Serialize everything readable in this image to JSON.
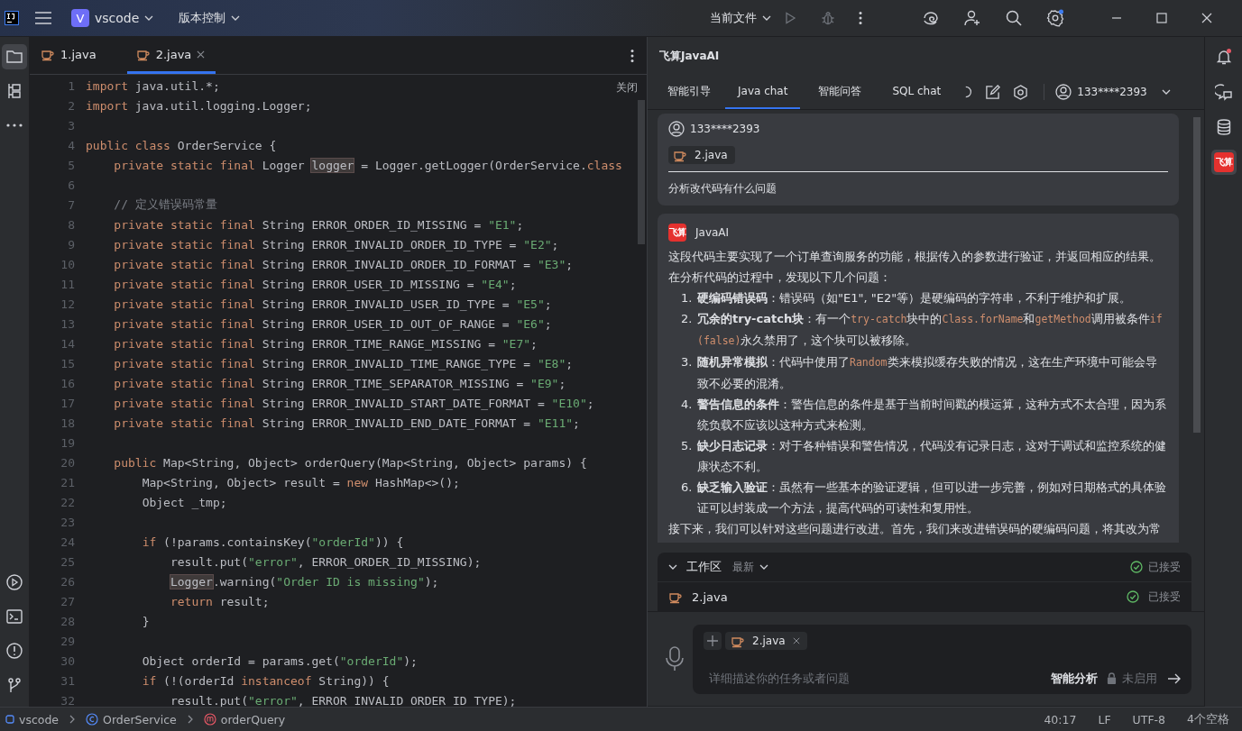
{
  "title_bar": {
    "project_badge": "V",
    "project": "vscode",
    "vcs": "版本控制",
    "run_config": "当前文件"
  },
  "left_toolbar": [
    {
      "kind": "folder",
      "selected": true
    },
    {
      "kind": "structure",
      "selected": false
    },
    {
      "kind": "more",
      "selected": false
    }
  ],
  "left_toolbar_bottom": [
    {
      "kind": "services"
    },
    {
      "kind": "terminal"
    },
    {
      "kind": "problems"
    },
    {
      "kind": "git"
    }
  ],
  "editor": {
    "tabs": [
      {
        "label": "1.java",
        "selected": false
      },
      {
        "label": "2.java",
        "selected": true
      }
    ],
    "close_hint": "关闭",
    "lines": [
      {
        "number": "1",
        "segments": [
          {
            "kind": "kw",
            "text": "import"
          },
          {
            "kind": "pl",
            "text": " java.util.*;"
          }
        ]
      },
      {
        "number": "2",
        "segments": [
          {
            "kind": "kw",
            "text": "import"
          },
          {
            "kind": "pl",
            "text": " java.util.logging.Logger;"
          }
        ]
      },
      {
        "number": "3"
      },
      {
        "number": "4",
        "segments": [
          {
            "kind": "kw",
            "text": "public class"
          },
          {
            "kind": "pl",
            "text": " OrderService {"
          }
        ]
      },
      {
        "number": "5",
        "segments": [
          {
            "kind": "kw",
            "text": "    private static final"
          },
          {
            "kind": "pl",
            "text": " Logger "
          },
          {
            "kind": "hl",
            "text": "logger"
          },
          {
            "kind": "pl",
            "text": " = Logger.getLogger(OrderService."
          },
          {
            "kind": "kw",
            "text": "class"
          }
        ]
      },
      {
        "number": "6"
      },
      {
        "number": "7",
        "segments": [
          {
            "kind": "cmt",
            "text": "    // 定义错误码常量"
          }
        ]
      },
      {
        "number": "8",
        "segments": [
          {
            "kind": "kw",
            "text": "    private static final"
          },
          {
            "kind": "pl",
            "text": " String ERROR_ORDER_ID_MISSING = "
          },
          {
            "kind": "str",
            "text": "\"E1\""
          },
          {
            "kind": "pl",
            "text": ";"
          }
        ]
      },
      {
        "number": "9",
        "segments": [
          {
            "kind": "kw",
            "text": "    private static final"
          },
          {
            "kind": "pl",
            "text": " String ERROR_INVALID_ORDER_ID_TYPE = "
          },
          {
            "kind": "str",
            "text": "\"E2\""
          },
          {
            "kind": "pl",
            "text": ";"
          }
        ]
      },
      {
        "number": "10",
        "segments": [
          {
            "kind": "kw",
            "text": "    private static final"
          },
          {
            "kind": "pl",
            "text": " String ERROR_INVALID_ORDER_ID_FORMAT = "
          },
          {
            "kind": "str",
            "text": "\"E3\""
          },
          {
            "kind": "pl",
            "text": ";"
          }
        ]
      },
      {
        "number": "11",
        "segments": [
          {
            "kind": "kw",
            "text": "    private static final"
          },
          {
            "kind": "pl",
            "text": " String ERROR_USER_ID_MISSING = "
          },
          {
            "kind": "str",
            "text": "\"E4\""
          },
          {
            "kind": "pl",
            "text": ";"
          }
        ]
      },
      {
        "number": "12",
        "segments": [
          {
            "kind": "kw",
            "text": "    private static final"
          },
          {
            "kind": "pl",
            "text": " String ERROR_INVALID_USER_ID_TYPE = "
          },
          {
            "kind": "str",
            "text": "\"E5\""
          },
          {
            "kind": "pl",
            "text": ";"
          }
        ]
      },
      {
        "number": "13",
        "segments": [
          {
            "kind": "kw",
            "text": "    private static final"
          },
          {
            "kind": "pl",
            "text": " String ERROR_USER_ID_OUT_OF_RANGE = "
          },
          {
            "kind": "str",
            "text": "\"E6\""
          },
          {
            "kind": "pl",
            "text": ";"
          }
        ]
      },
      {
        "number": "14",
        "segments": [
          {
            "kind": "kw",
            "text": "    private static final"
          },
          {
            "kind": "pl",
            "text": " String ERROR_TIME_RANGE_MISSING = "
          },
          {
            "kind": "str",
            "text": "\"E7\""
          },
          {
            "kind": "pl",
            "text": ";"
          }
        ]
      },
      {
        "number": "15",
        "segments": [
          {
            "kind": "kw",
            "text": "    private static final"
          },
          {
            "kind": "pl",
            "text": " String ERROR_INVALID_TIME_RANGE_TYPE = "
          },
          {
            "kind": "str",
            "text": "\"E8\""
          },
          {
            "kind": "pl",
            "text": ";"
          }
        ]
      },
      {
        "number": "16",
        "segments": [
          {
            "kind": "kw",
            "text": "    private static final"
          },
          {
            "kind": "pl",
            "text": " String ERROR_TIME_SEPARATOR_MISSING = "
          },
          {
            "kind": "str",
            "text": "\"E9\""
          },
          {
            "kind": "pl",
            "text": ";"
          }
        ]
      },
      {
        "number": "17",
        "segments": [
          {
            "kind": "kw",
            "text": "    private static final"
          },
          {
            "kind": "pl",
            "text": " String ERROR_INVALID_START_DATE_FORMAT = "
          },
          {
            "kind": "str",
            "text": "\"E10\""
          },
          {
            "kind": "pl",
            "text": ";"
          }
        ]
      },
      {
        "number": "18",
        "segments": [
          {
            "kind": "kw",
            "text": "    private static final"
          },
          {
            "kind": "pl",
            "text": " String ERROR_INVALID_END_DATE_FORMAT = "
          },
          {
            "kind": "str",
            "text": "\"E11\""
          },
          {
            "kind": "pl",
            "text": ";"
          }
        ]
      },
      {
        "number": "19"
      },
      {
        "number": "20",
        "segments": [
          {
            "kind": "kw",
            "text": "    public"
          },
          {
            "kind": "pl",
            "text": " Map<String, Object> orderQuery(Map<String, Object> params) {"
          }
        ]
      },
      {
        "number": "21",
        "segments": [
          {
            "kind": "pl",
            "text": "        Map<String, Object> result = "
          },
          {
            "kind": "kw",
            "text": "new"
          },
          {
            "kind": "pl",
            "text": " HashMap<>();"
          }
        ]
      },
      {
        "number": "22",
        "segments": [
          {
            "kind": "pl",
            "text": "        Object _tmp;"
          }
        ]
      },
      {
        "number": "23"
      },
      {
        "number": "24",
        "segments": [
          {
            "kind": "kw",
            "text": "        if"
          },
          {
            "kind": "pl",
            "text": " (!params.containsKey("
          },
          {
            "kind": "str",
            "text": "\"orderId\""
          },
          {
            "kind": "pl",
            "text": ")) {"
          }
        ]
      },
      {
        "number": "25",
        "segments": [
          {
            "kind": "pl",
            "text": "            result.put("
          },
          {
            "kind": "str",
            "text": "\"error\""
          },
          {
            "kind": "pl",
            "text": ", ERROR_ORDER_ID_MISSING);"
          }
        ]
      },
      {
        "number": "26",
        "segments": [
          {
            "kind": "hl",
            "text": "            Logger"
          },
          {
            "kind": "pl",
            "text": ".warning("
          },
          {
            "kind": "str",
            "text": "\"Order ID is missing\""
          },
          {
            "kind": "pl",
            "text": ");"
          }
        ]
      },
      {
        "number": "27",
        "segments": [
          {
            "kind": "kw",
            "text": "            return"
          },
          {
            "kind": "pl",
            "text": " result;"
          }
        ]
      },
      {
        "number": "28",
        "segments": [
          {
            "kind": "pl",
            "text": "        }"
          }
        ]
      },
      {
        "number": "29"
      },
      {
        "number": "30",
        "segments": [
          {
            "kind": "pl",
            "text": "        Object orderId = params.get("
          },
          {
            "kind": "str",
            "text": "\"orderId\""
          },
          {
            "kind": "pl",
            "text": ");"
          }
        ]
      },
      {
        "number": "31",
        "segments": [
          {
            "kind": "kw",
            "text": "        if"
          },
          {
            "kind": "pl",
            "text": " (!(orderId "
          },
          {
            "kind": "kw",
            "text": "instanceof"
          },
          {
            "kind": "pl",
            "text": " String)) {"
          }
        ]
      },
      {
        "number": "32",
        "segments": [
          {
            "kind": "pl",
            "text": "            result.put("
          },
          {
            "kind": "str",
            "text": "\"error\""
          },
          {
            "kind": "pl",
            "text": ", ERROR_INVALID_ORDER_ID_TYPE);"
          }
        ]
      }
    ]
  },
  "chat_panel": {
    "title": "飞算JavaAI",
    "tabs": [
      {
        "label": "智能引导",
        "selected": false
      },
      {
        "label": "Java chat",
        "selected": true
      },
      {
        "label": "智能问答",
        "selected": false
      },
      {
        "label": "SQL chat",
        "selected": false
      }
    ],
    "account": "133****2393",
    "messages": [
      {
        "kind": "user",
        "author": "133****2393",
        "file": "2.java",
        "text": "分析改代码有什么问题"
      },
      {
        "kind": "ai",
        "author": "JavaAI",
        "logo_text": "飞算",
        "intro": "这段代码主要实现了一个订单查询服务的功能，根据传入的参数进行验证，并返回相应的结果。在分析代码的过程中，发现以下几个问题：",
        "items": [
          {
            "number": "1.",
            "segments": [
              {
                "kind": "b",
                "text": "硬编码错误码"
              },
              {
                "kind": "t",
                "text": "：错误码（如\"E1\", \"E2\"等）是硬编码的字符串，不利于维护和扩展。"
              }
            ]
          },
          {
            "number": "2.",
            "segments": [
              {
                "kind": "b",
                "text": "冗余的try-catch块"
              },
              {
                "kind": "t",
                "text": "：有一个"
              },
              {
                "kind": "code",
                "text": "try-catch"
              },
              {
                "kind": "t",
                "text": "块中的"
              },
              {
                "kind": "code",
                "text": "Class.forName"
              },
              {
                "kind": "t",
                "text": "和"
              },
              {
                "kind": "code",
                "text": "getMethod"
              },
              {
                "kind": "t",
                "text": "调用被条件"
              },
              {
                "kind": "code",
                "text": "if (false)"
              },
              {
                "kind": "t",
                "text": "永久禁用了，这个块可以被移除。"
              }
            ]
          },
          {
            "number": "3.",
            "segments": [
              {
                "kind": "b",
                "text": "随机异常模拟"
              },
              {
                "kind": "t",
                "text": "：代码中使用了"
              },
              {
                "kind": "code",
                "text": "Random"
              },
              {
                "kind": "t",
                "text": "类来模拟缓存失败的情况，这在生产环境中可能会导致不必要的混淆。"
              }
            ]
          },
          {
            "number": "4.",
            "segments": [
              {
                "kind": "b",
                "text": "警告信息的条件"
              },
              {
                "kind": "t",
                "text": "：警告信息的条件是基于当前时间戳的模运算，这种方式不太合理，因为系统负载不应该以这种方式来检测。"
              }
            ]
          },
          {
            "number": "5.",
            "segments": [
              {
                "kind": "b",
                "text": "缺少日志记录"
              },
              {
                "kind": "t",
                "text": "：对于各种错误和警告情况，代码没有记录日志，这对于调试和监控系统的健康状态不利。"
              }
            ]
          },
          {
            "number": "6.",
            "segments": [
              {
                "kind": "b",
                "text": "缺乏输入验证"
              },
              {
                "kind": "t",
                "text": "：虽然有一些基本的验证逻辑，但可以进一步完善，例如对日期格式的具体验证可以封装成一个方法，提高代码的可读性和复用性。"
              }
            ]
          }
        ],
        "outro": "接下来，我们可以针对这些问题进行改进。首先，我们来改进错误码的硬编码问题，将其改为常"
      }
    ]
  },
  "workspace": {
    "title": "工作区",
    "filter": "最新",
    "status": "已接受",
    "files": [
      {
        "name": "2.java",
        "status": "已接受"
      }
    ]
  },
  "input": {
    "chip": "2.java",
    "placeholder": "详细描述你的任务或者问题",
    "mode": "智能分析",
    "mode_state": "未启用"
  },
  "right_toolbar": [
    {
      "kind": "bell",
      "selected": false
    },
    {
      "kind": "chat",
      "selected": false
    },
    {
      "kind": "database",
      "selected": false
    },
    {
      "kind": "logo",
      "text": "飞算",
      "selected": true
    }
  ],
  "status_bar": {
    "breadcrumbs": [
      {
        "kind": "module",
        "label": "vscode"
      },
      {
        "kind": "class",
        "label": "OrderService"
      },
      {
        "kind": "method",
        "label": "orderQuery"
      }
    ],
    "items": [
      "40:17",
      "LF",
      "UTF-8",
      "4个空格"
    ]
  }
}
